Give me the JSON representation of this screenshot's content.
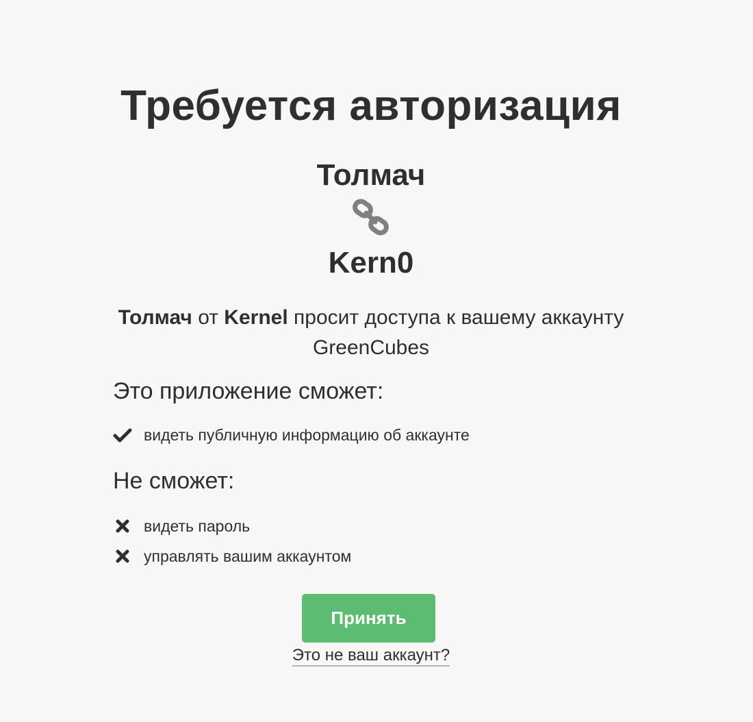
{
  "page": {
    "title": "Требуется авторизация",
    "app_name": "Толмач",
    "account_name": "Kern0"
  },
  "request": {
    "app": "Толмач",
    "from_word": "от",
    "developer": "Kernel",
    "text": "просит доступа к вашему аккаунту",
    "service": "GreenCubes"
  },
  "permissions": {
    "can_heading": "Это приложение сможет:",
    "can": [
      {
        "label": "видеть публичную информацию об аккаунте",
        "icon": "check-icon"
      }
    ],
    "cannot_heading": "Не сможет:",
    "cannot": [
      {
        "label": "видеть пароль",
        "icon": "cross-icon"
      },
      {
        "label": "управлять вашим аккаунтом",
        "icon": "cross-icon"
      }
    ]
  },
  "actions": {
    "accept_label": "Принять",
    "not_you_label": "Это не ваш аккаунт?"
  },
  "colors": {
    "background": "#f7f7f7",
    "text": "#2f2f2f",
    "accept_button": "#5cbd72",
    "link_icon": "#808080"
  }
}
